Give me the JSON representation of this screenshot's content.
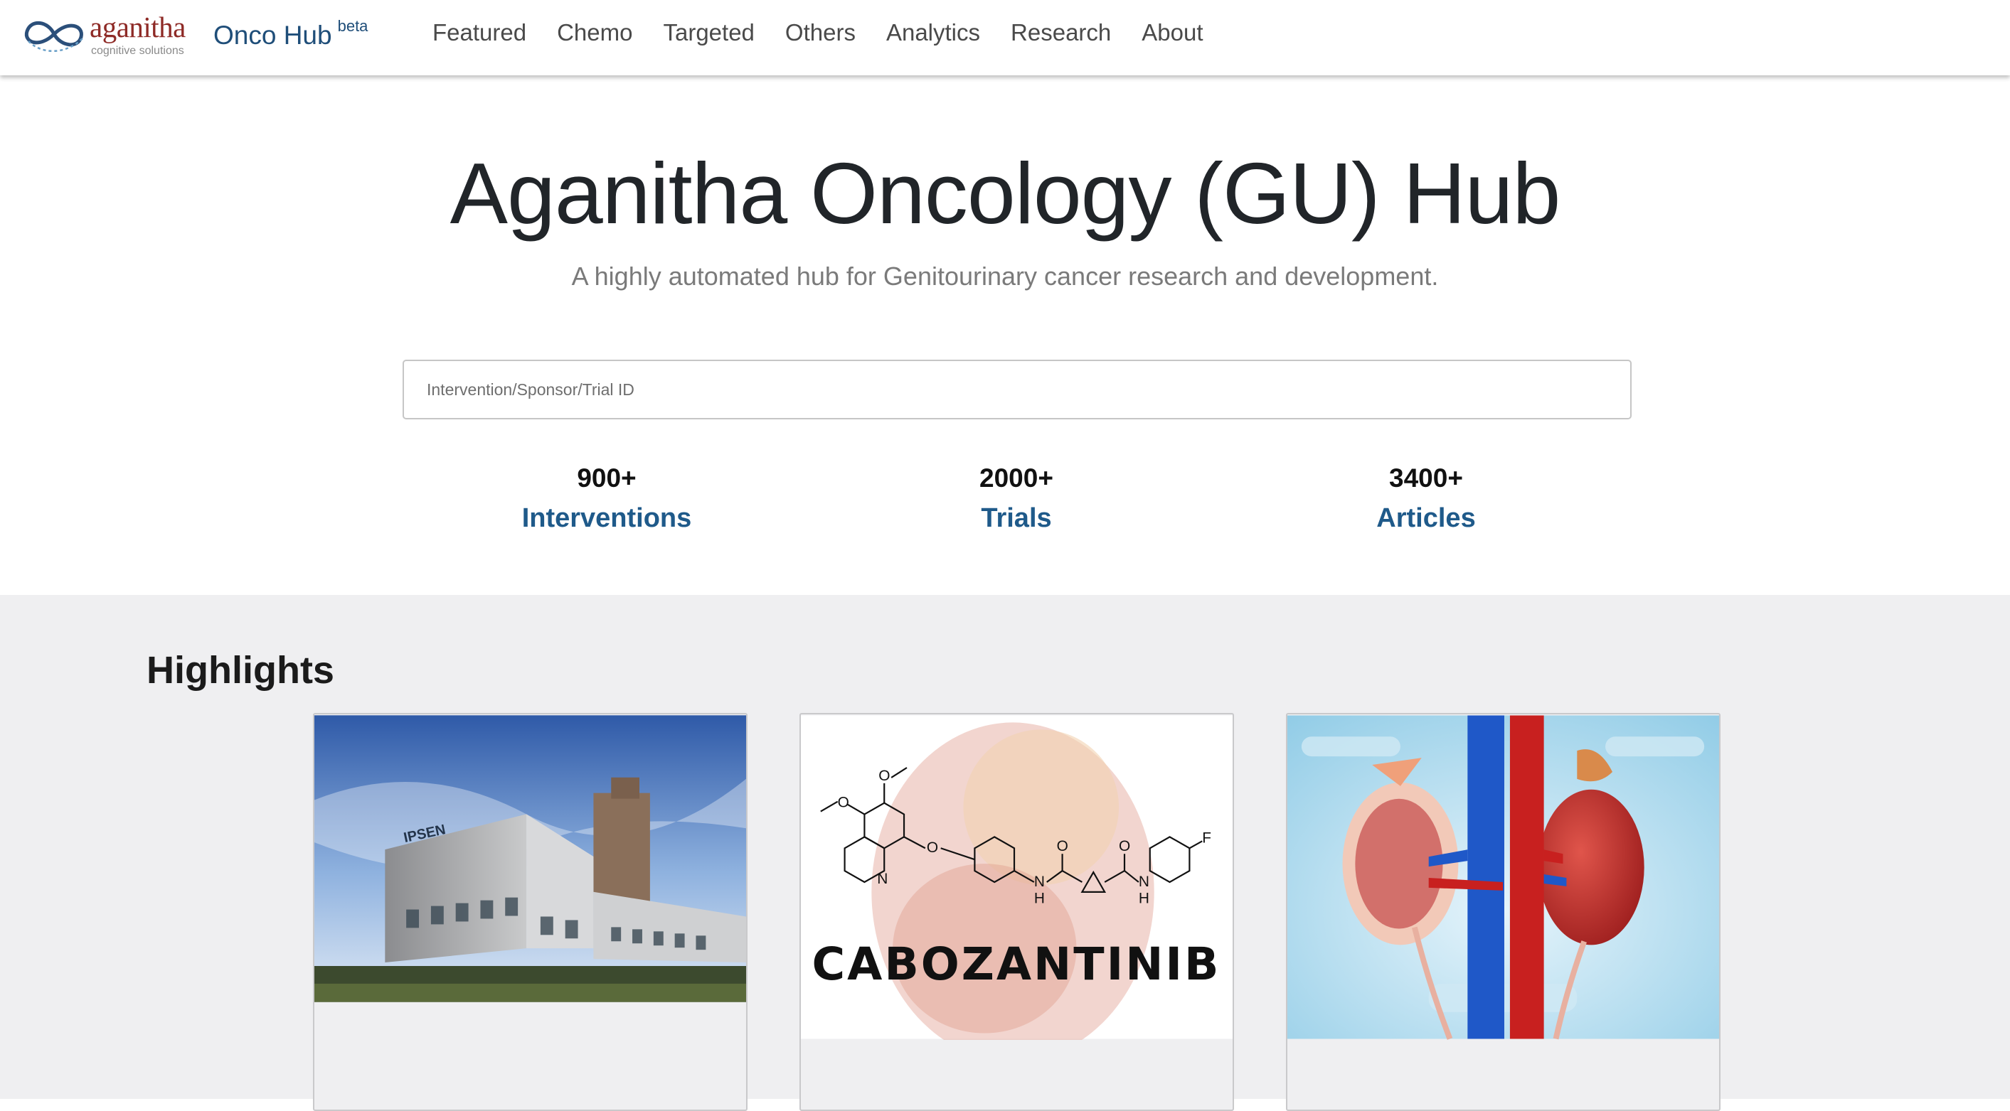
{
  "brand": {
    "name": "aganitha",
    "tagline": "cognitive solutions",
    "app_name": "Onco Hub",
    "app_badge": "beta"
  },
  "nav": {
    "items": [
      "Featured",
      "Chemo",
      "Targeted",
      "Others",
      "Analytics",
      "Research",
      "About"
    ]
  },
  "hero": {
    "title": "Aganitha Oncology (GU) Hub",
    "subtitle": "A highly automated hub for Genitourinary cancer research and development.",
    "search_placeholder": "Intervention/Sponsor/Trial ID"
  },
  "stats": [
    {
      "value": "900+",
      "label": "Interventions"
    },
    {
      "value": "2000+",
      "label": "Trials"
    },
    {
      "value": "3400+",
      "label": "Articles"
    }
  ],
  "highlights": {
    "title": "Highlights",
    "cards": [
      {
        "image": "ipsen-building-photo",
        "sign_text": "IPSEN"
      },
      {
        "image": "cabozantinib-structure",
        "caption": "CABOZANTINIB",
        "atoms": [
          "O",
          "O",
          "N",
          "O",
          "O",
          "O",
          "N",
          "H",
          "N",
          "H",
          "F"
        ]
      },
      {
        "image": "kidney-anatomy-illustration"
      }
    ]
  },
  "colors": {
    "brand_red": "#8e2a26",
    "brand_blue": "#1f4e79",
    "stat_link": "#1f5a8a",
    "highlights_bg": "#efeff1"
  }
}
